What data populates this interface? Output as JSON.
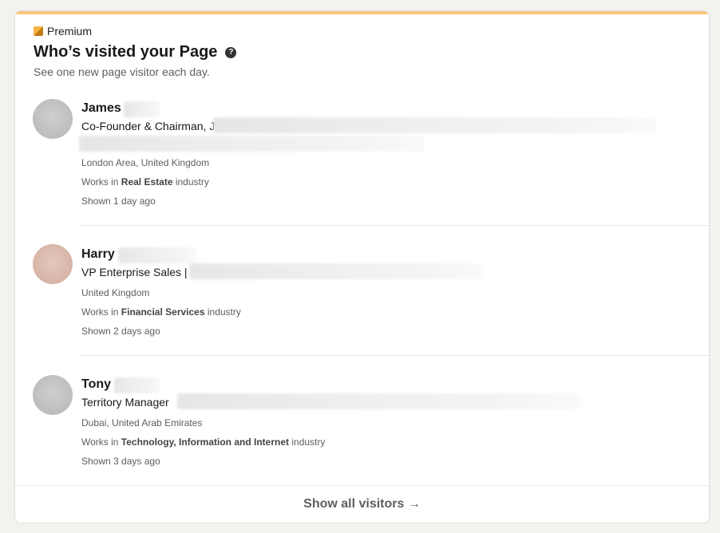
{
  "premium_label": "Premium",
  "title": "Who’s visited your Page",
  "help_glyph": "?",
  "subtitle": "See one new page visitor each day.",
  "visitors": [
    {
      "name": "James",
      "headline": "Co-Founder & Chairman, J",
      "location": "London Area, United Kingdom",
      "works_prefix": "Works in ",
      "industry": "Real Estate",
      "works_suffix": " industry",
      "shown": "Shown 1 day ago"
    },
    {
      "name": "Harry",
      "headline": "VP Enterprise Sales |",
      "location": "United Kingdom",
      "works_prefix": "Works in ",
      "industry": "Financial Services",
      "works_suffix": " industry",
      "shown": "Shown 2 days ago"
    },
    {
      "name": "Tony",
      "headline": "Territory Manager",
      "location": "Dubai, United Arab Emirates",
      "works_prefix": "Works in ",
      "industry": "Technology, Information and Internet",
      "works_suffix": " industry",
      "shown": "Shown 3 days ago"
    }
  ],
  "show_all_label": "Show all visitors",
  "show_all_arrow": "→",
  "colors": {
    "premium_bar": "#f8c77e",
    "background": "#f4f2ee"
  },
  "icons": {
    "premium": "premium-badge-icon",
    "help": "help-icon",
    "arrow": "arrow-right-icon"
  }
}
